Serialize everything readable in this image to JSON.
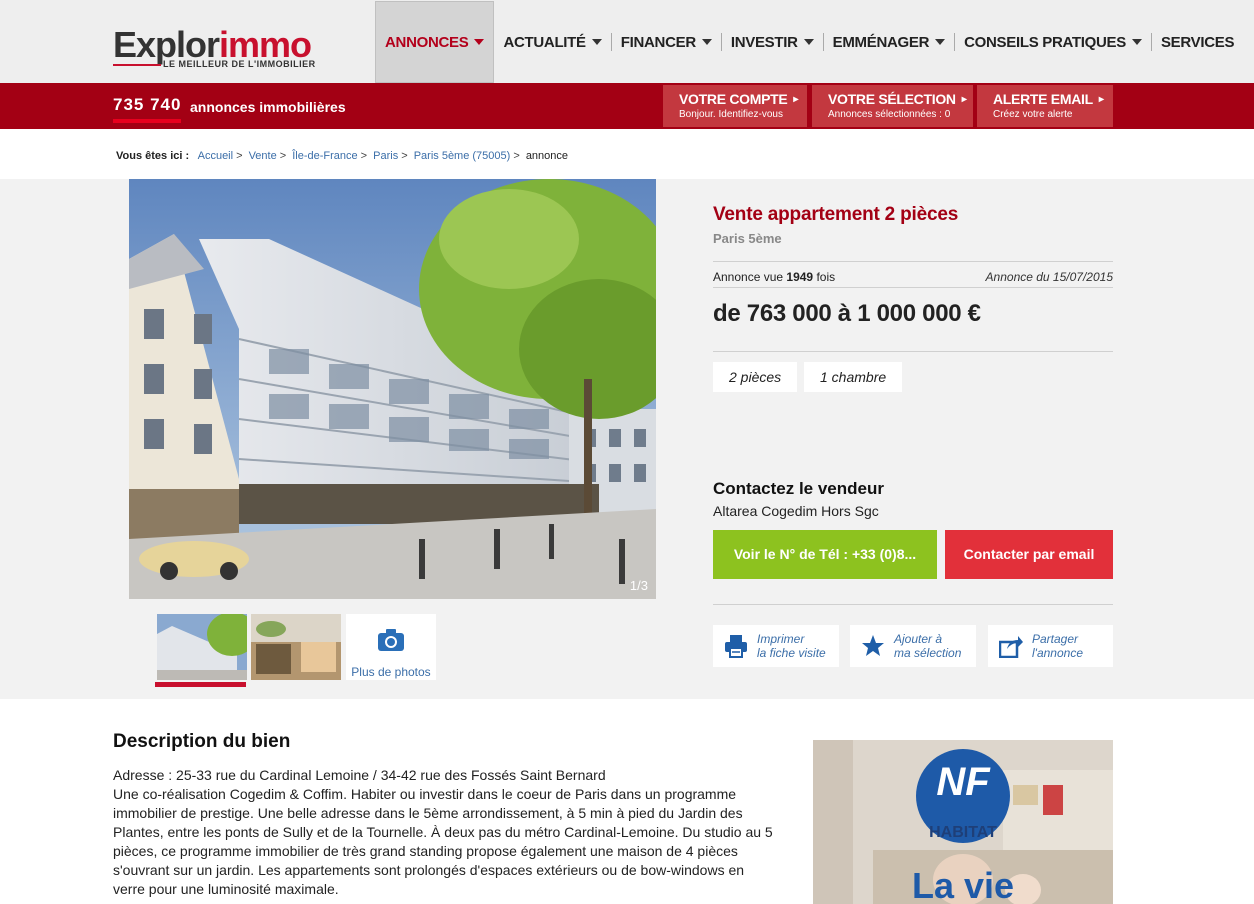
{
  "header": {
    "logo": {
      "main_a": "Explor",
      "main_b": "immo",
      "tagline": "LE MEILLEUR DE L'IMMOBILIER"
    },
    "nav": [
      {
        "label": "ANNONCES",
        "active": true,
        "caret": true
      },
      {
        "label": "ACTUALITÉ",
        "caret": true
      },
      {
        "label": "FINANCER",
        "caret": true
      },
      {
        "label": "INVESTIR",
        "caret": true
      },
      {
        "label": "EMMÉNAGER",
        "caret": true
      },
      {
        "label": "CONSEILS PRATIQUES",
        "caret": true
      },
      {
        "label": "SERVICES",
        "caret": false
      }
    ]
  },
  "redbar": {
    "count": "735 740",
    "count_label": "annonces immobilières",
    "account": {
      "title": "VOTRE COMPTE",
      "sub": "Bonjour. Identifiez-vous"
    },
    "selection": {
      "title": "VOTRE SÉLECTION",
      "sub": "Annonces sélectionnées : 0"
    },
    "alert": {
      "title": "ALERTE EMAIL",
      "sub": "Créez votre alerte"
    }
  },
  "breadcrumb": {
    "label": "Vous êtes ici :",
    "items": [
      "Accueil",
      "Vente",
      "Île-de-France",
      "Paris",
      "Paris 5ème (75005)"
    ],
    "current": "annonce"
  },
  "gallery": {
    "counter": "1/3",
    "more_photos": "Plus de photos"
  },
  "listing": {
    "title": "Vente appartement 2 pièces",
    "location": "Paris 5ème",
    "views_prefix": "Annonce vue",
    "views": "1949",
    "views_suffix": "fois",
    "date": "Annonce du 15/07/2015",
    "price": "de 763 000 à 1 000 000 €",
    "tags": [
      "2 pièces",
      "1 chambre"
    ]
  },
  "contact": {
    "heading": "Contactez le vendeur",
    "seller": "Altarea Cogedim Hors Sgc",
    "phone_button": "Voir le N° de Tél : +33 (0)8...",
    "email_button": "Contacter par email"
  },
  "actions": [
    {
      "icon": "printer-icon",
      "line1": "Imprimer",
      "line2": "la fiche visite"
    },
    {
      "icon": "star-icon",
      "line1": "Ajouter à",
      "line2": "ma sélection"
    },
    {
      "icon": "share-icon",
      "line1": "Partager",
      "line2": "l'annonce"
    }
  ],
  "description": {
    "heading": "Description du bien",
    "lines": [
      "Adresse : 25-33 rue du Cardinal Lemoine / 34-42 rue des Fossés Saint Bernard",
      "Une co-réalisation Cogedim & Coffim. Habiter ou investir dans le coeur de Paris dans un programme immobilier de prestige. Une belle adresse dans le 5ème arrondissement, à 5 min à pied du Jardin des Plantes, entre les ponts de Sully et de la Tournelle. À deux pas du métro Cardinal-Lemoine. Du studio au 5 pièces, ce programme immobilier de très grand standing propose également une maison de 4 pièces s'ouvrant sur un jardin. Les appartements sont prolongés d'espaces extérieurs ou de bow-windows en verre pour une luminosité maximale."
    ]
  },
  "ad": {
    "brand": "NF",
    "brand_sub": "HABITAT",
    "tagline": "La vie"
  },
  "colors": {
    "brand_red": "#a30014",
    "accent_red": "#c8102e",
    "green": "#8dc21f",
    "link_blue": "#3b6ea8"
  }
}
